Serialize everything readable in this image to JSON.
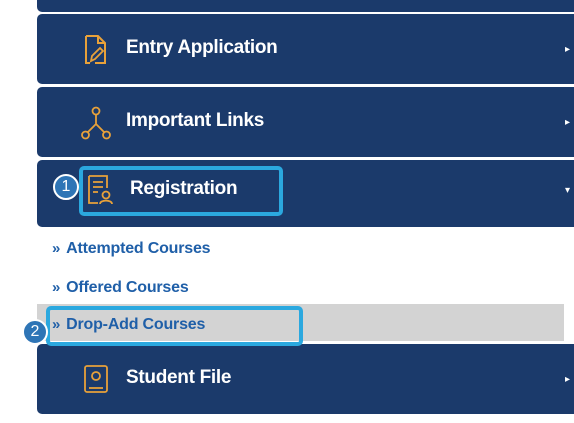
{
  "menu": [
    {
      "label": "Entry Application",
      "icon": "document-edit-icon"
    },
    {
      "label": "Important Links",
      "icon": "network-links-icon"
    },
    {
      "label": "Registration",
      "icon": "registration-form-icon",
      "expanded": true
    },
    {
      "label": "Student File",
      "icon": "student-profile-icon"
    }
  ],
  "submenu": {
    "marker": "»",
    "items": [
      {
        "label": "Attempted Courses"
      },
      {
        "label": "Offered Courses"
      },
      {
        "label": "Drop-Add Courses",
        "active": true
      }
    ]
  },
  "annotations": [
    {
      "number": "1",
      "target": "Registration"
    },
    {
      "number": "2",
      "target": "Drop-Add Courses"
    }
  ],
  "colors": {
    "menu_bg": "#1b3a6b",
    "icon_orange": "#e8a13a",
    "link_blue": "#1f5fa8",
    "highlight": "#2ba8df",
    "badge": "#2e75b6",
    "active_bg": "#d3d3d3"
  }
}
